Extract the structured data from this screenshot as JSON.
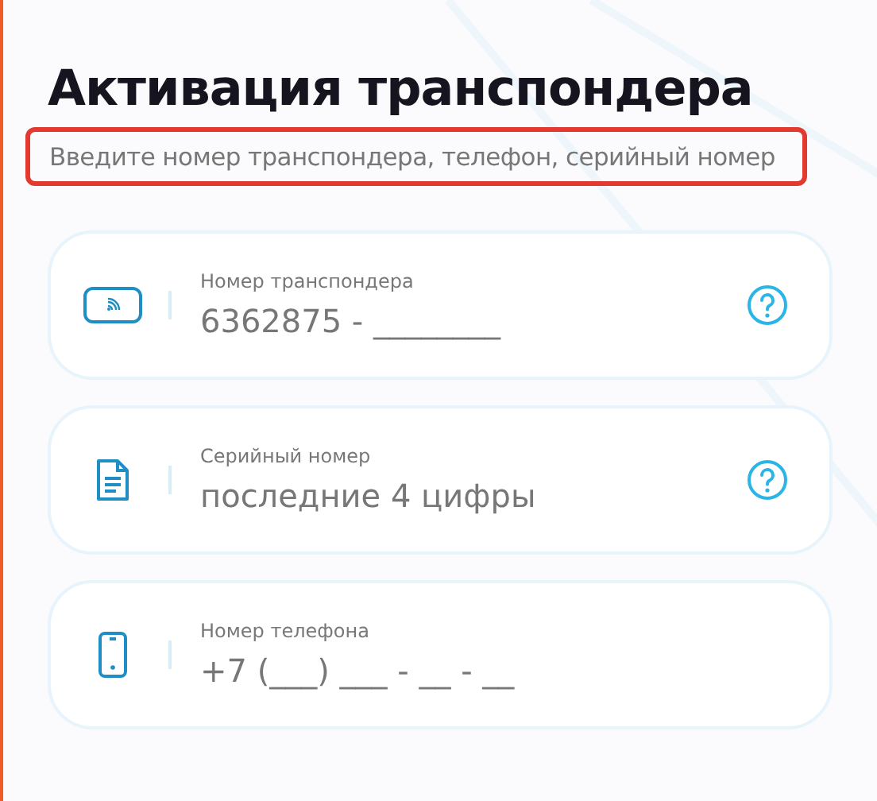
{
  "title": "Активация транспондера",
  "subtitle": {
    "text": "Введите номер транспондера, телефон, серийный номер",
    "highlighted": true
  },
  "fields": [
    {
      "kind": "transponder",
      "label": "Номер транспондера",
      "placeholder": "6362875 - ________",
      "help": true
    },
    {
      "kind": "serial",
      "label": "Серийный номер",
      "placeholder": "последние 4 цифры",
      "help": true
    },
    {
      "kind": "phone",
      "label": "Номер телефона",
      "placeholder": "+7 (___) ___ - __ - __",
      "help": false
    }
  ]
}
